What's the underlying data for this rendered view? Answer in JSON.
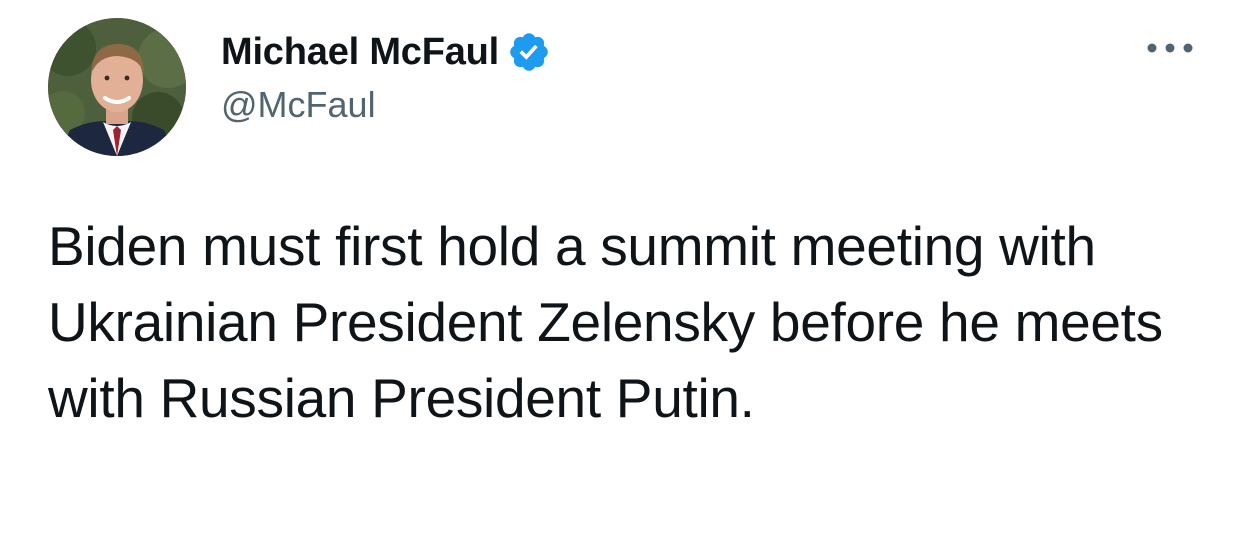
{
  "author": {
    "display_name": "Michael McFaul",
    "handle": "@McFaul",
    "verified": true,
    "verified_color": "#1d9bf0"
  },
  "tweet": {
    "text": "Biden must first hold a summit meeting with Ukrainian President Zelensky before he meets with Russian President Putin."
  },
  "icons": {
    "more": "more-horizontal-icon",
    "verified": "verified-badge-icon"
  },
  "colors": {
    "text": "#0f1419",
    "secondary": "#536471"
  }
}
